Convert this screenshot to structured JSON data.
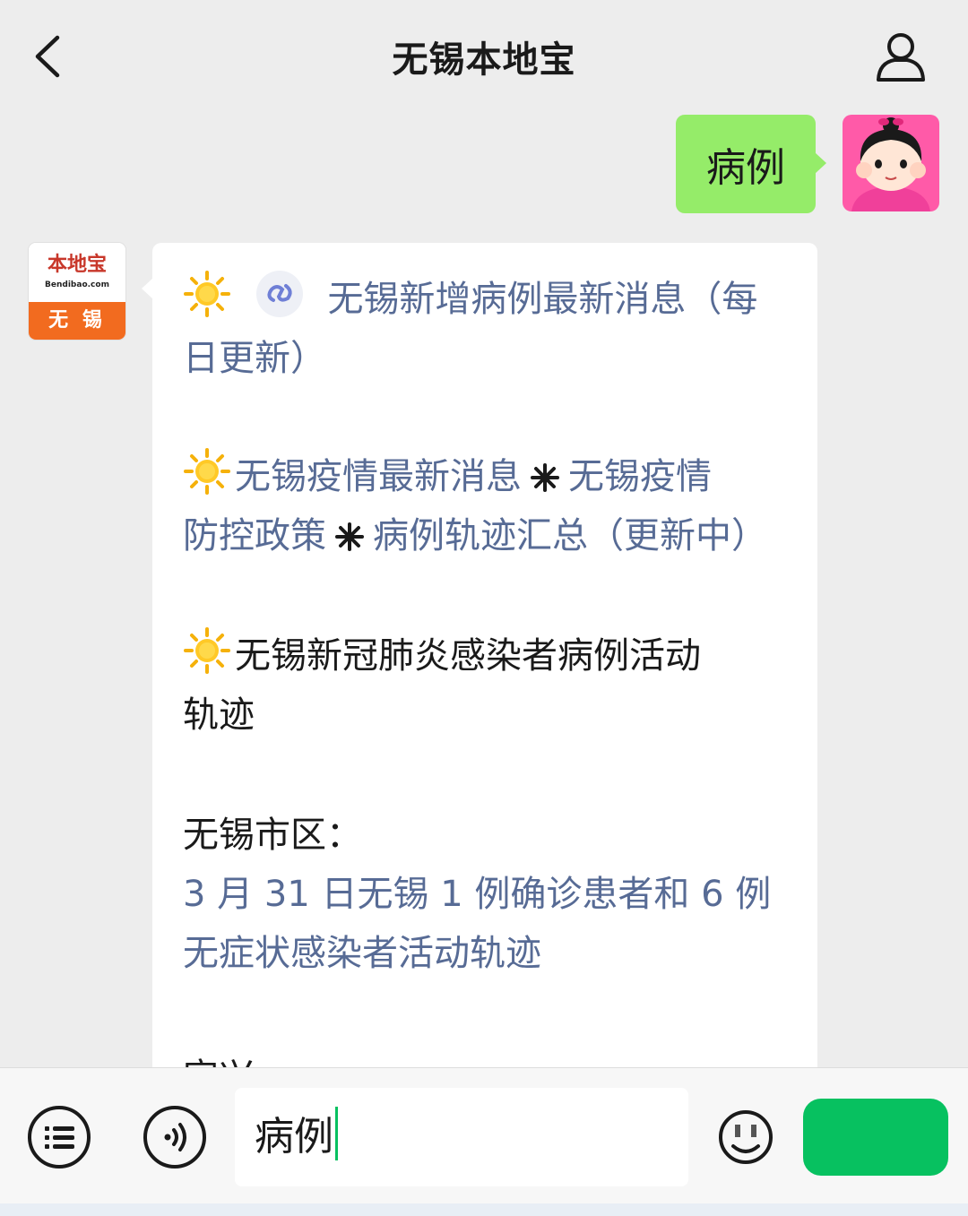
{
  "header": {
    "title": "无锡本地宝"
  },
  "outgoing": {
    "text": "病例"
  },
  "sender": {
    "logo_name": "本地宝",
    "logo_url": "Bendibao.com",
    "logo_city": "无 锡"
  },
  "incoming": {
    "item1_link": "无锡新增病例最新消息（每",
    "item1_link_cont": "日更新）",
    "item2_link_a": "无锡疫情最新消息",
    "item2_link_b": "无锡疫情",
    "item2_link_c": "防控政策",
    "item2_link_d": "病例轨迹汇总（更新中）",
    "item3_text": "无锡新冠肺炎感染者病例活动",
    "item3_text_cont": "轨迹",
    "section_title": "无锡市区：",
    "item4_link": "3 月 31 日无锡 1 例确诊患者和 6 例",
    "item4_link_cont": "无症状感染者活动轨迹",
    "cut_text": "宜兴"
  },
  "input": {
    "value": "病例"
  },
  "colors": {
    "link": "#576b95",
    "bubble_out": "#95ec69",
    "send": "#07c160",
    "logo_orange": "#f26b1f"
  },
  "icons": [
    "back-icon",
    "user-profile-icon",
    "sun-icon",
    "mini-program-link-icon",
    "asterisk-icon",
    "menu-list-icon",
    "voice-icon",
    "emoji-icon"
  ]
}
